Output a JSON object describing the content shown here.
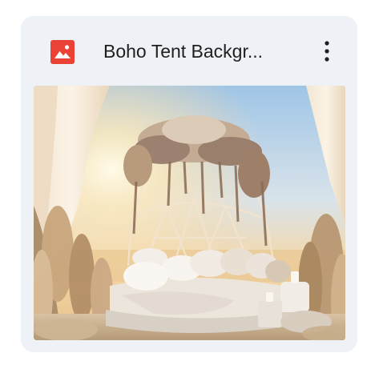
{
  "file": {
    "title": "Boho Tent Backgr...",
    "type_icon": "image-icon",
    "type_icon_color": "#ea4335"
  },
  "actions": {
    "more_icon": "more-vert-icon"
  },
  "thumbnail": {
    "alt": "Boho Tent Background",
    "sky_color": "#a9cbe6",
    "sun_color": "#fff4d6"
  }
}
